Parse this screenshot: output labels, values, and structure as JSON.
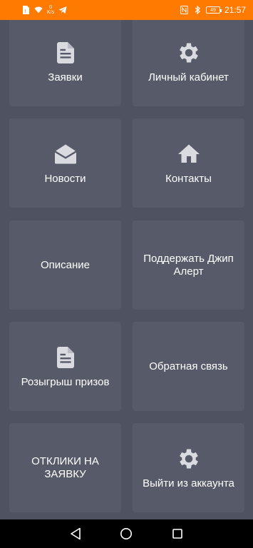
{
  "status_bar": {
    "speed_value": "0",
    "speed_unit": "K/s",
    "battery": "49",
    "time": "21:57"
  },
  "tiles": [
    {
      "label": "Заявки",
      "icon": "document-icon"
    },
    {
      "label": "Личный кабинет",
      "icon": "gear-icon"
    },
    {
      "label": "Новости",
      "icon": "open-envelope-icon"
    },
    {
      "label": "Контакты",
      "icon": "home-icon"
    },
    {
      "label": "Описание",
      "icon": ""
    },
    {
      "label": "Поддержать Джип Алерт",
      "icon": ""
    },
    {
      "label": "Розыгрыш призов",
      "icon": "document-icon"
    },
    {
      "label": "Обратная связь",
      "icon": ""
    },
    {
      "label": "ОТКЛИКИ НА ЗАЯВКУ",
      "icon": ""
    },
    {
      "label": "Выйти из аккаунта",
      "icon": "gear-icon"
    }
  ],
  "colors": {
    "status_bar": "#ff7a00",
    "background": "#4e5261",
    "tile": "#575b69",
    "text": "#ffffff",
    "icon": "#d9dbe0"
  }
}
